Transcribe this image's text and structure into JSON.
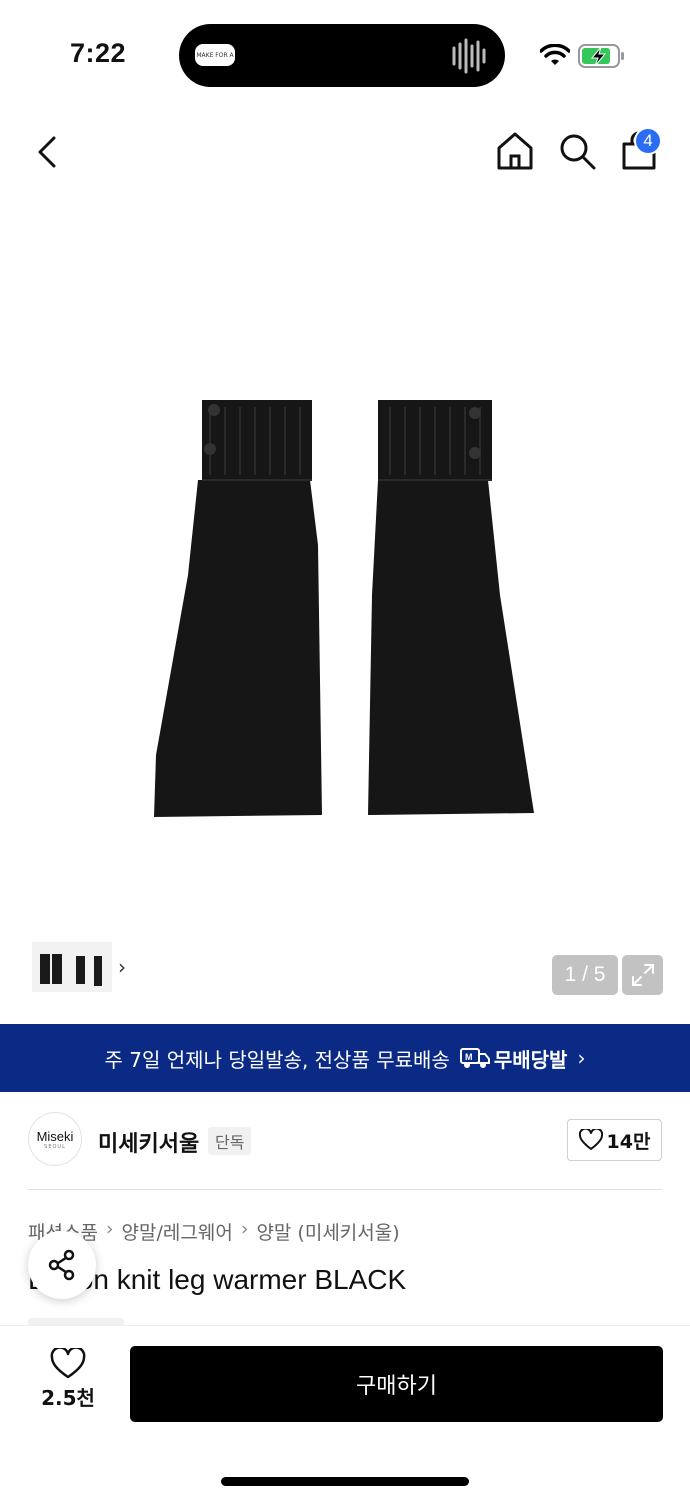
{
  "status_bar": {
    "time": "7:22",
    "island_label": "MAKE FOR A",
    "icons": [
      "wifi-icon",
      "battery-charging-icon"
    ]
  },
  "header": {
    "icons": [
      "back-icon",
      "home-icon",
      "search-icon",
      "shopping-bag-icon"
    ],
    "cart_badge": "4"
  },
  "gallery": {
    "counter": "1 / 5",
    "thumbnail_arrow": "›"
  },
  "banner": {
    "text": "주 7일 언제나 당일발송, 전상품 무료배송",
    "logo_text": "무배당발",
    "chevron": "›",
    "color": "#0b2a86"
  },
  "brand": {
    "logo_text": "Miseki",
    "logo_sub": "SEOUL",
    "name": "미세키서울",
    "tag": "단독",
    "likes": "14만"
  },
  "breadcrumb": [
    "패션소품",
    "양말/레그웨어",
    "양말 (미세키서울)"
  ],
  "product": {
    "title": "Button knit leg warmer BLACK"
  },
  "bottom_bar": {
    "wish_count": "2.5천",
    "buy_label": "구매하기"
  },
  "colors": {
    "accent": "#2a6df4",
    "primary_button": "#000000"
  }
}
